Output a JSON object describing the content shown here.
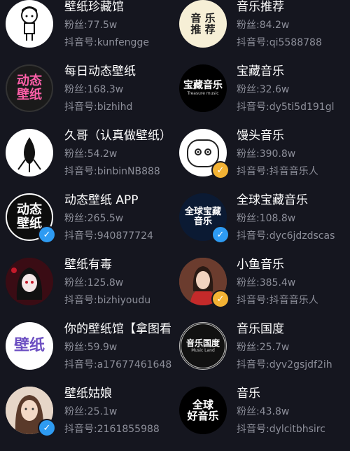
{
  "follower_prefix": "粉丝:",
  "id_prefix": "抖音号:",
  "left": [
    {
      "name": "壁纸珍藏馆",
      "followers": "77.5w",
      "douyin_id": "kunfengge"
    },
    {
      "name": "每日动态壁纸",
      "followers": "168.3w",
      "douyin_id": "bizhihd",
      "avatar_text": "动态\n壁纸"
    },
    {
      "name": "久哥（认真做壁纸）",
      "followers": "54.2w",
      "douyin_id": "binbinNB888"
    },
    {
      "name": "动态壁纸 APP",
      "followers": "265.5w",
      "douyin_id": "940877724",
      "avatar_text": "动态\n壁纸"
    },
    {
      "name": "壁纸有毒",
      "followers": "125.8w",
      "douyin_id": "bizhiyoudu"
    },
    {
      "name": "你的壁纸馆【拿图看",
      "followers": "59.9w",
      "douyin_id": "a17677461648",
      "avatar_text": "壁纸"
    },
    {
      "name": "壁纸姑娘",
      "followers": "25.1w",
      "douyin_id": "2161855988"
    }
  ],
  "right": [
    {
      "name": "音乐推荐",
      "followers": "84.2w",
      "douyin_id": "qi5588788",
      "avatar_text": "音 乐\n推 荐"
    },
    {
      "name": "宝藏音乐",
      "followers": "32.6w",
      "douyin_id": "dy5ti5d191gl",
      "avatar_text": "宝藏音乐",
      "avatar_sub": "Treasure music"
    },
    {
      "name": "馒头音乐",
      "followers": "390.8w",
      "douyin_id": "抖音音乐人"
    },
    {
      "name": "全球宝藏音乐",
      "followers": "108.8w",
      "douyin_id": "dyc6jdzdscas",
      "avatar_text": "全球宝藏\n音乐"
    },
    {
      "name": "小鱼音乐",
      "followers": "385.4w",
      "douyin_id": "抖音音乐人"
    },
    {
      "name": "音乐国度",
      "followers": "25.7w",
      "douyin_id": "dyv2gsjdf2ih",
      "avatar_text": "音乐国度",
      "avatar_sub": "Music Land"
    },
    {
      "name": "音乐",
      "followers": "43.8w",
      "douyin_id": "dylcitbhsirc",
      "avatar_text": "全球\n好音乐"
    }
  ],
  "colors": {
    "background": "#15161f",
    "verified_blue": "#2e9bf2",
    "musician_gold": "#f2b234",
    "subtext": "#8d8f9a"
  }
}
